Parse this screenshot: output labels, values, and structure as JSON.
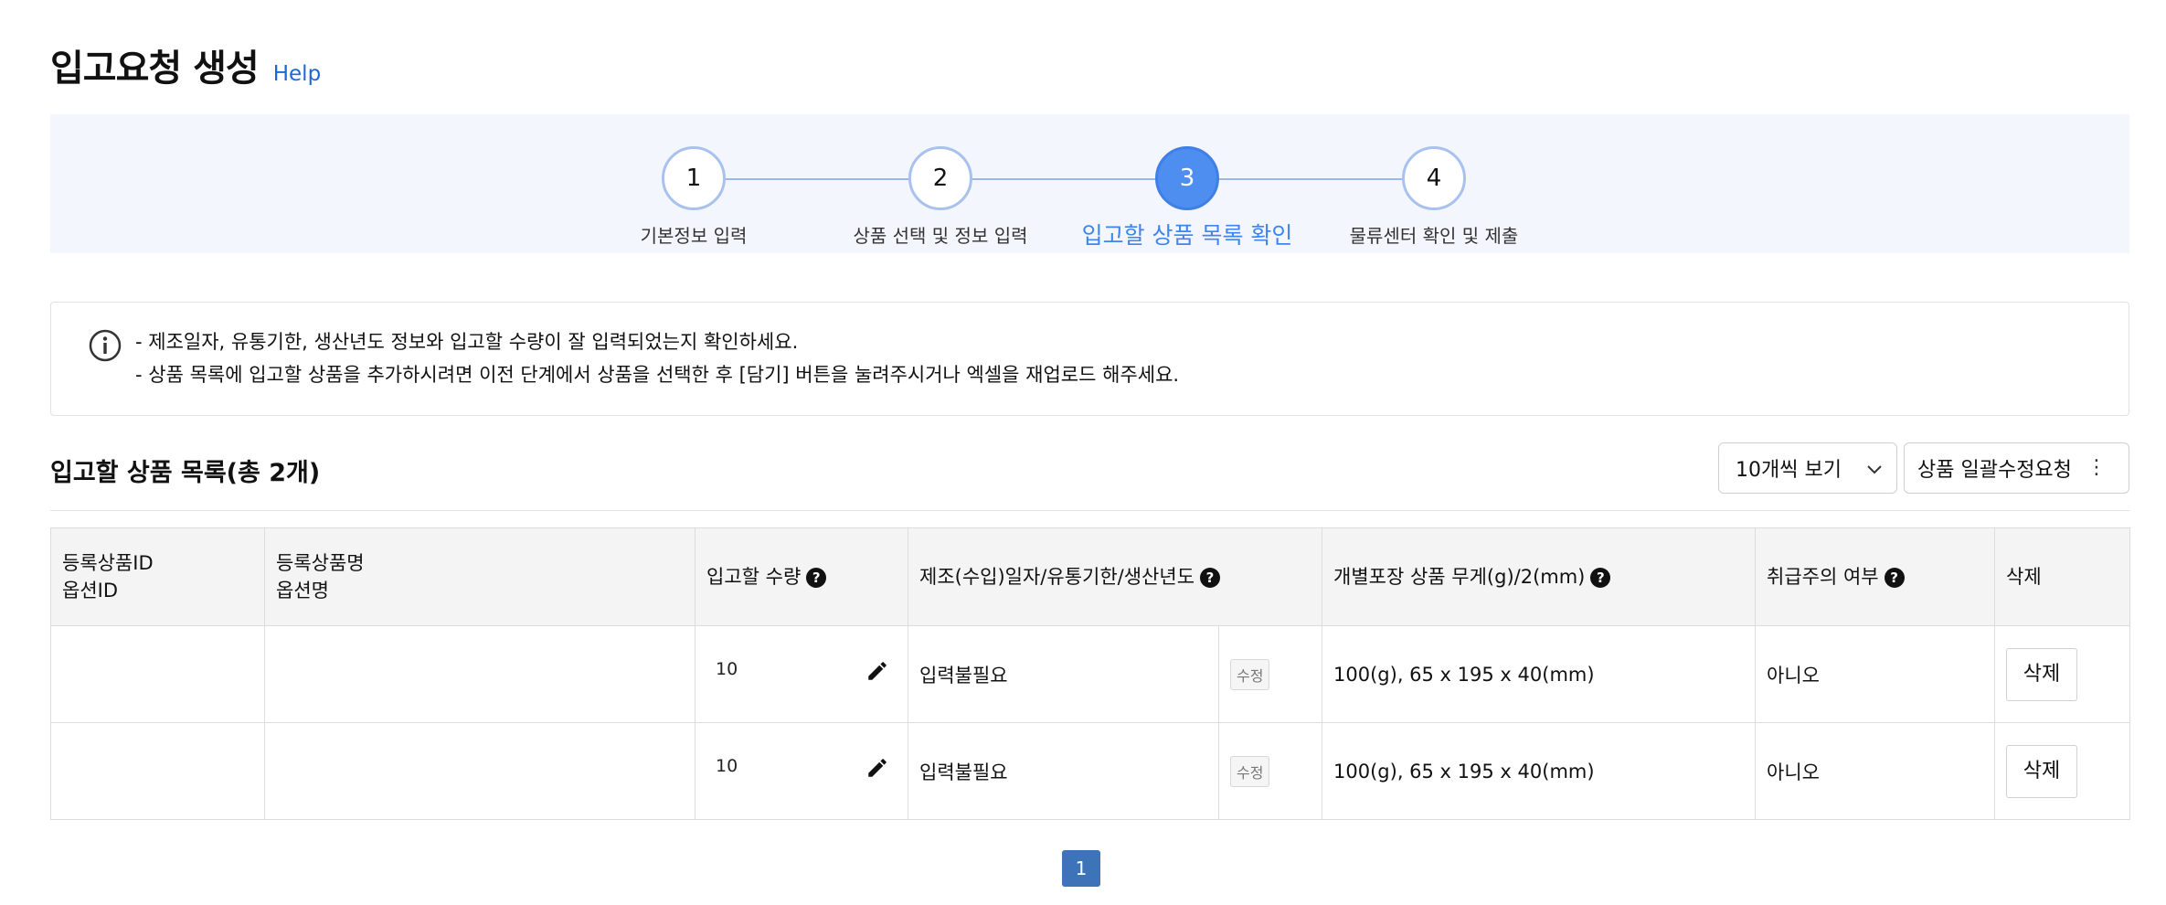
{
  "header": {
    "title": "입고요청 생성",
    "help": "Help"
  },
  "stepper": {
    "steps": [
      {
        "number": "1",
        "label": "기본정보 입력"
      },
      {
        "number": "2",
        "label": "상품 선택 및 정보 입력"
      },
      {
        "number": "3",
        "label": "입고할 상품 목록 확인"
      },
      {
        "number": "4",
        "label": "물류센터 확인 및 제출"
      }
    ],
    "active_step": 3
  },
  "notice": {
    "lines": [
      "- 제조일자, 유통기한, 생산년도 정보와 입고할 수량이 잘 입력되었는지 확인하세요.",
      "- 상품 목록에 입고할 상품을 추가하시려면 이전 단계에서 상품을 선택한 후 [담기] 버튼을 눌려주시거나 엑셀을 재업로드 해주세요."
    ]
  },
  "list": {
    "title": "입고할 상품 목록(총 2개)",
    "page_size_select": "10개씩 보기",
    "bulk_edit_button": "상품 일괄수정요청"
  },
  "table": {
    "headers": {
      "product_id": "등록상품ID",
      "option_id": "옵션ID",
      "product_name": "등록상품명",
      "option_name": "옵션명",
      "quantity": "입고할 수량",
      "date_info": "제조(수입)일자/유통기한/생산년도",
      "weight": "개별포장 상품 무게(g)/2(mm)",
      "caution": "취급주의 여부",
      "delete": "삭제"
    },
    "rows": [
      {
        "quantity": "10",
        "date_info": "입력불필요",
        "edit_label": "수정",
        "weight": "100(g), 65 x 195 x 40(mm)",
        "caution": "아니오",
        "delete_label": "삭제"
      },
      {
        "quantity": "10",
        "date_info": "입력불필요",
        "edit_label": "수정",
        "weight": "100(g), 65 x 195 x 40(mm)",
        "caution": "아니오",
        "delete_label": "삭제"
      }
    ]
  },
  "pagination": {
    "current": "1"
  },
  "colors": {
    "accent": "#4d8ef0",
    "step_border": "#a8c1ef",
    "link": "#1f66d6",
    "pager": "#3d74b9"
  }
}
